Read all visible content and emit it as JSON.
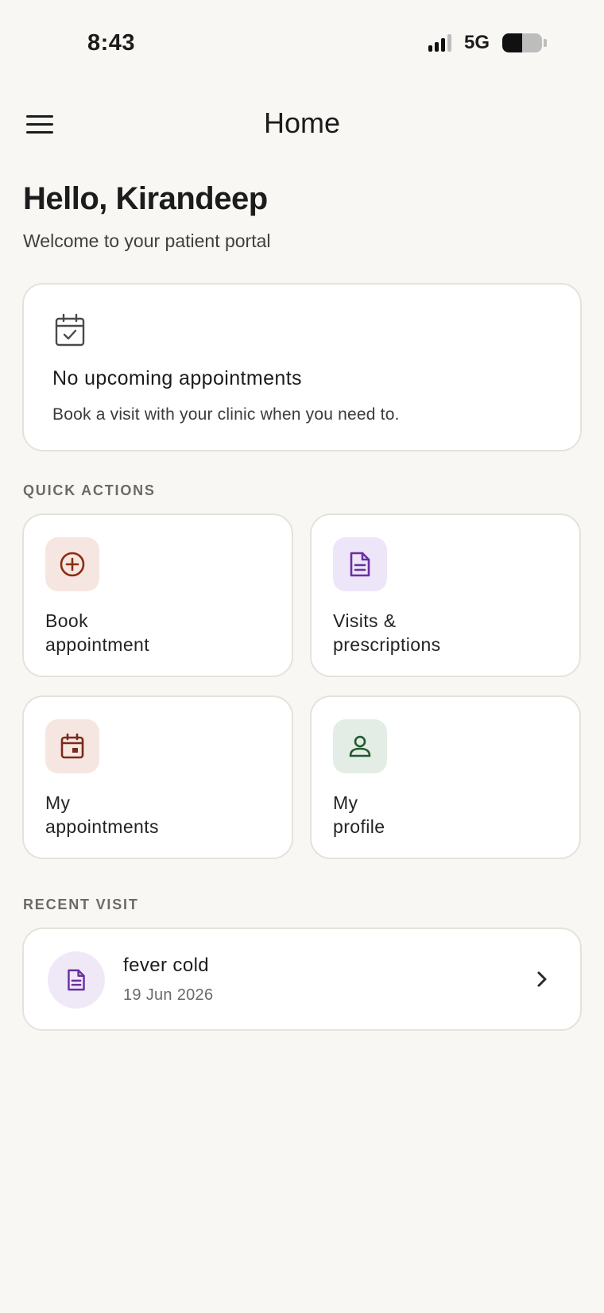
{
  "status_bar": {
    "time": "8:43",
    "network": "5G",
    "battery_level": 0.5
  },
  "header": {
    "title": "Home",
    "menu_icon": "menu-icon"
  },
  "greeting": {
    "title": "Hello, Kirandeep",
    "subtitle": "Welcome to your patient portal"
  },
  "appointment_card": {
    "icon": "calendar-check-icon",
    "title": "No upcoming appointments",
    "subtitle": "Book a visit with your clinic when you need to."
  },
  "quick_actions": {
    "label": "QUICK ACTIONS",
    "items": [
      {
        "line1": "Book",
        "line2": "appointment",
        "icon": "plus-circle-icon",
        "color": "#8a2d12"
      },
      {
        "line1": "Visits &",
        "line2": "prescriptions",
        "icon": "document-icon",
        "color": "#6a2fa0"
      },
      {
        "line1": "My",
        "line2": "appointments",
        "icon": "calendar-icon",
        "color": "#7a2a1a"
      },
      {
        "line1": "My",
        "line2": "profile",
        "icon": "person-icon",
        "color": "#1f5a2e"
      }
    ]
  },
  "recent_visit": {
    "label": "RECENT VISIT",
    "title": "fever cold",
    "date": "19 Jun 2026",
    "icon": "document-icon"
  },
  "colors": {
    "background": "#f8f7f3",
    "card": "#ffffff",
    "border": "#e5e2dc"
  }
}
